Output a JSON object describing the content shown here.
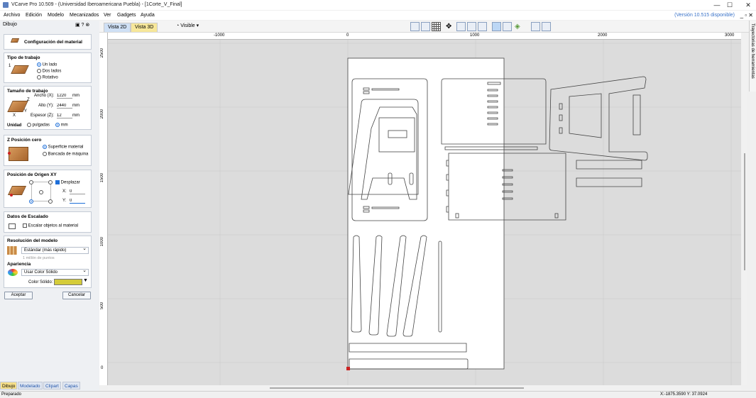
{
  "window": {
    "title": "VCarve Pro 10.509 - (Universidad Iberoamericana Puebla) - [1Corte_V_Final]",
    "minimize": "—",
    "maximize": "☐",
    "close": "✕"
  },
  "menu": {
    "items": [
      "Archivo",
      "Edición",
      "Modelo",
      "Mecanizados",
      "Ver",
      "Gadgets",
      "Ayuda"
    ],
    "version_notice": "(Versión 10.515 disponible)"
  },
  "toolbar": {
    "tab_2d": "Vista 2D",
    "tab_3d": "Vista 3D",
    "visible_label": "Visible"
  },
  "left_panel": {
    "header": "Dibujo",
    "material_button": "Configuración del material",
    "job_type": {
      "title": "Tipo de trabajo",
      "options": [
        "Un lado",
        "Dos lados",
        "Rotativo"
      ],
      "selected": "Un lado",
      "marker": "1"
    },
    "job_size": {
      "title": "Tamaño de trabajo",
      "width_label": "Ancho (X):",
      "width_value": "1220",
      "height_label": "Alto (Y):",
      "height_value": "2440",
      "thickness_label": "Espesor (Z):",
      "thickness_value": "12",
      "unit": "mm",
      "units_label": "Unidad",
      "unit_options": [
        "pulgadas",
        "mm"
      ],
      "unit_selected": "mm",
      "axes": [
        "Z",
        "Y",
        "X"
      ]
    },
    "z_zero": {
      "title": "Z Posición cero",
      "options": [
        "Superficie material",
        "Bancada de máquina"
      ],
      "selected": "Superficie material"
    },
    "xy_origin": {
      "title": "Posición de Origen XY",
      "offset_label": "Desplazar",
      "x_label": "X:",
      "x_value": "0",
      "y_label": "Y:",
      "y_value": "0"
    },
    "scaling": {
      "title": "Datos de Escalado",
      "checkbox_label": "Escalar objetos al material"
    },
    "resolution": {
      "title": "Resolución del modelo",
      "selected": "Estándar (más rápido)",
      "hint": "1 millón de puntos"
    },
    "appearance": {
      "title": "Apariencia",
      "selected": "Usar Color Sólido",
      "color_label": "Color Sólido:",
      "color_value": "#d4cc3a"
    },
    "ok_button": "Aceptar",
    "cancel_button": "Cancelar",
    "bottom_tabs": [
      "Dibujo",
      "Modelado",
      "Clipart",
      "Capas"
    ],
    "active_tab": "Dibujo"
  },
  "rulers": {
    "h_labels": [
      "-1000",
      "0",
      "1000",
      "2000",
      "3000"
    ],
    "v_labels": [
      "2500",
      "2000",
      "1500",
      "1000",
      "500",
      "0"
    ]
  },
  "right_tab": "Trayectorias de herramientas",
  "status": {
    "left": "Preparado",
    "coords": "X:-1875.3590 Y: 37.0924"
  },
  "colors": {
    "accent": "#1e6fd9",
    "sheet": "#ffffff",
    "canvas_bg": "#dcdcdc",
    "origin": "#cc2222"
  }
}
